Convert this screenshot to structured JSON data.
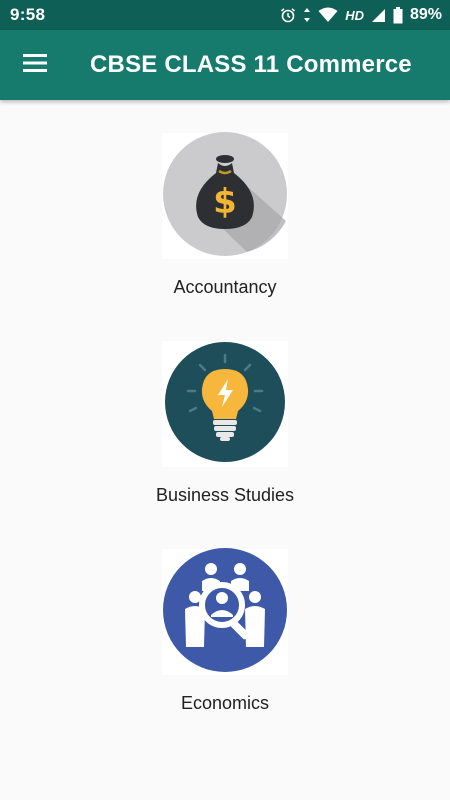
{
  "status_bar": {
    "time": "9:58",
    "network": "HD",
    "battery": "89%",
    "icons": [
      "alarm-icon",
      "data-arrows-icon",
      "wifi-icon",
      "signal-icon",
      "battery-icon"
    ]
  },
  "app_bar": {
    "menu_icon": "hamburger-menu-icon",
    "title": "CBSE CLASS 11 Commerce"
  },
  "subjects": [
    {
      "label": "Accountancy",
      "icon": "money-bag-icon",
      "color": "#c9c9c9"
    },
    {
      "label": "Business Studies",
      "icon": "light-bulb-icon",
      "color": "#1f4e5b"
    },
    {
      "label": "Economics",
      "icon": "people-magnifier-icon",
      "color": "#3d59a8"
    }
  ],
  "colors": {
    "status_bar": "#0e5f55",
    "app_bar": "#167a6c",
    "background": "#fafafa"
  }
}
